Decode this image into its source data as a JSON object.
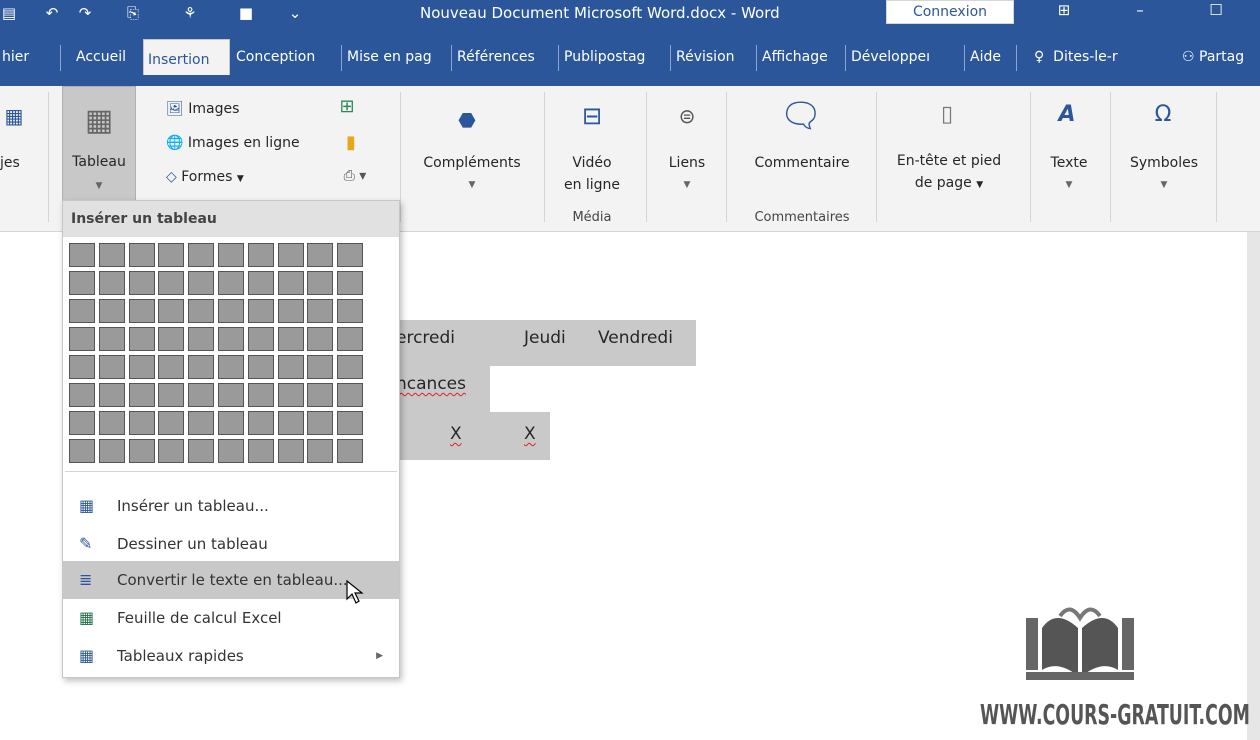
{
  "titlebar": {
    "doc_title": "Nouveau Document Microsoft Word.docx  -  Word",
    "login": "Connexion"
  },
  "tabs": [
    {
      "label": "Fichier",
      "visible": "hier"
    },
    {
      "label": "Accueil"
    },
    {
      "label": "Insertion"
    },
    {
      "label": "Conception"
    },
    {
      "label": "Mise en pag"
    },
    {
      "label": "Références"
    },
    {
      "label": "Publipostag"
    },
    {
      "label": "Révision"
    },
    {
      "label": "Affichage"
    },
    {
      "label": "Développeı"
    },
    {
      "label": "Aide"
    }
  ],
  "tell_me": "Dites-le-r",
  "share": "Partag",
  "ribbon": {
    "pages_partial": "jes",
    "tableau": "Tableau",
    "images": "Images",
    "images_en_ligne": "Images en ligne",
    "formes": "Formes",
    "complements": "Compléments",
    "video_line1": "Vidéo",
    "video_line2": "en ligne",
    "liens": "Liens",
    "commentaire": "Commentaire",
    "entete_line1": "En-tête et pied",
    "entete_line2": "de page",
    "texte": "Texte",
    "symboles": "Symboles",
    "group_media": "Média",
    "group_commentaires": "Commentaires"
  },
  "document": {
    "text_mercredi": "ercredi",
    "text_jeudi": "Jeudi",
    "text_vendredi": "Vendredi",
    "text_vacances": "ncances",
    "text_x1": "X",
    "text_x2": "X"
  },
  "menu": {
    "header": "Insérer un tableau",
    "grid_cols": 10,
    "grid_rows": 8,
    "items": [
      {
        "label": "Insérer un tableau...",
        "icon": "table-icon"
      },
      {
        "label": "Dessiner un tableau",
        "icon": "draw-table-icon"
      },
      {
        "label": "Convertir le texte en tableau...",
        "icon": "convert-text-icon",
        "hover": true
      },
      {
        "label": "Feuille de calcul Excel",
        "icon": "excel-icon"
      },
      {
        "label": "Tableaux rapides",
        "icon": "quick-tables-icon",
        "submenu": true
      }
    ]
  },
  "watermark": {
    "text": "WWW.COURS-GRATUIT.COM"
  },
  "colors": {
    "accent": "#2b579a",
    "ribbon_bg": "#f3f3f3",
    "shade": "#c9c9c9"
  }
}
